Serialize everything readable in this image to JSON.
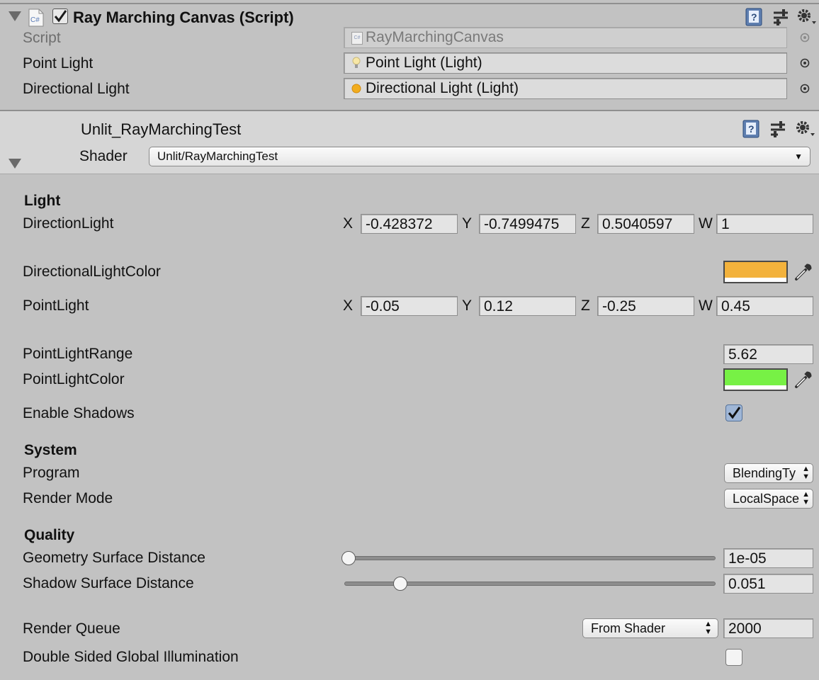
{
  "script_component": {
    "title": "Ray Marching Canvas (Script)",
    "rows": [
      {
        "label": "Script",
        "value": "RayMarchingCanvas"
      },
      {
        "label": "Point Light",
        "value": "Point Light (Light)"
      },
      {
        "label": "Directional Light",
        "value": "Directional Light (Light)"
      }
    ]
  },
  "material": {
    "name": "Unlit_RayMarchingTest",
    "shader_label": "Shader",
    "shader_value": "Unlit/RayMarchingTest"
  },
  "sections": {
    "light": "Light",
    "system": "System",
    "quality": "Quality"
  },
  "light": {
    "direction_label": "DirectionLight",
    "direction": {
      "x": "-0.428372",
      "y": "-0.7499475",
      "z": "0.5040597",
      "w": "1"
    },
    "dir_color_label": "DirectionalLightColor",
    "point_label": "PointLight",
    "point": {
      "x": "-0.05",
      "y": "0.12",
      "z": "-0.25",
      "w": "0.45"
    },
    "range_label": "PointLightRange",
    "range_value": "5.62",
    "point_color_label": "PointLightColor",
    "shadows_label": "Enable Shadows"
  },
  "axes": {
    "x": "X",
    "y": "Y",
    "z": "Z",
    "w": "W"
  },
  "system": {
    "program_label": "Program",
    "program_value": "BlendingTy",
    "render_mode_label": "Render Mode",
    "render_mode_value": "LocalSpace"
  },
  "quality": {
    "geo_label": "Geometry Surface Distance",
    "geo_value": "1e-05",
    "geo_fraction": 0.0,
    "shadow_label": "Shadow Surface Distance",
    "shadow_value": "0.051",
    "shadow_fraction": 0.14
  },
  "footer": {
    "queue_label": "Render Queue",
    "queue_option": "From Shader",
    "queue_value": "2000",
    "gi_label": "Double Sided Global Illumination"
  },
  "colors": {
    "directional_light_color": "#f3b23c",
    "point_light_color": "#77f145",
    "panel_bg": "#c2c2c2",
    "header_bg": "#d6d6d6"
  },
  "icons": [
    "foldout-arrow-icon",
    "csharp-script-icon",
    "help-book-icon",
    "preset-sliders-icon",
    "gear-icon",
    "target-icon",
    "light-bulb-icon",
    "sun-icon",
    "eyedropper-icon",
    "checkmark-icon"
  ]
}
